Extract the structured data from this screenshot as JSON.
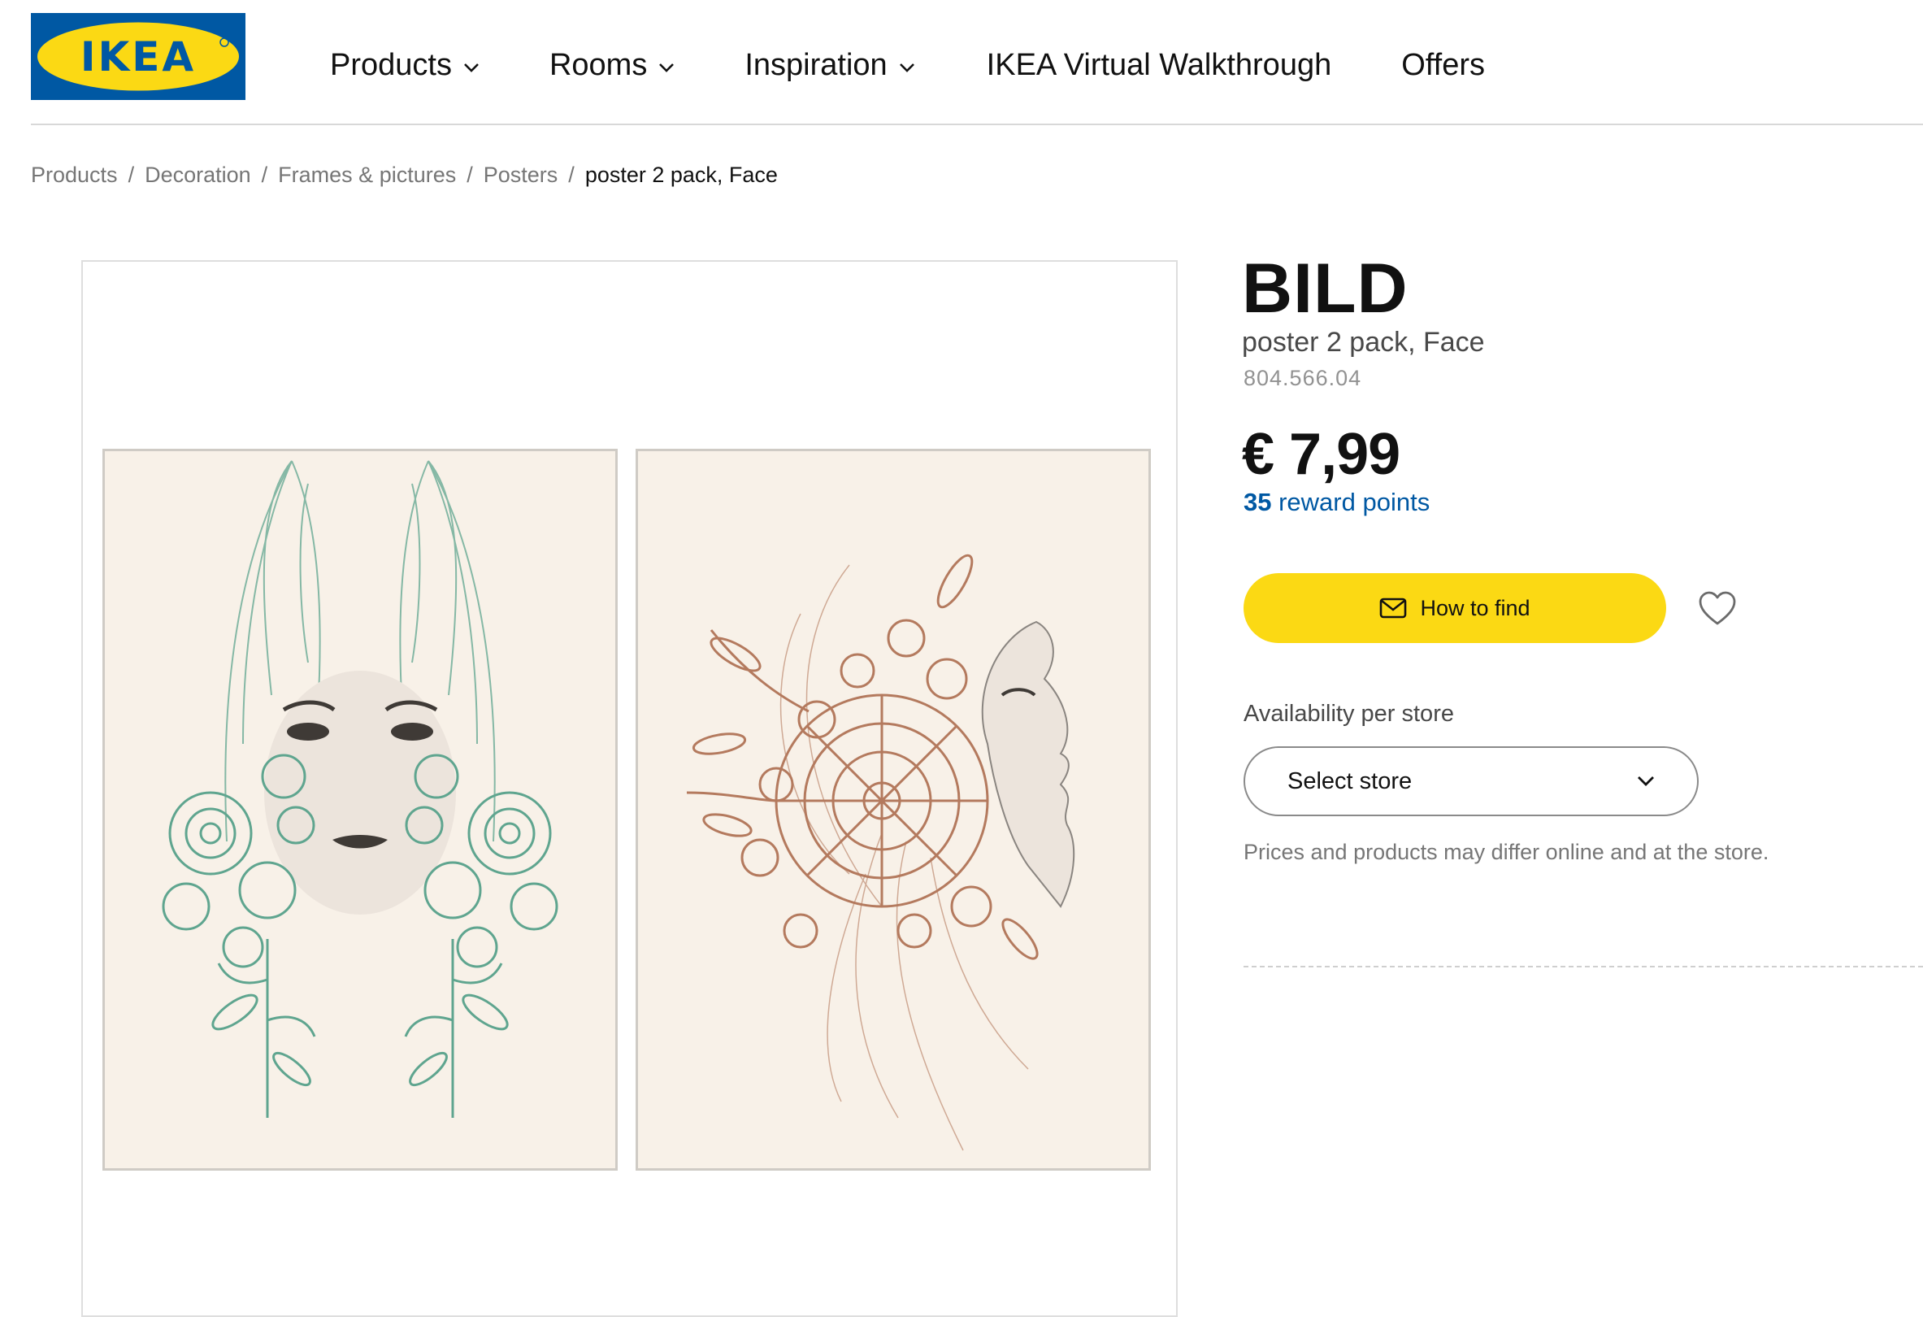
{
  "header": {
    "logo_text": "IKEA",
    "nav": [
      {
        "label": "Products",
        "has_dropdown": true
      },
      {
        "label": "Rooms",
        "has_dropdown": true
      },
      {
        "label": "Inspiration",
        "has_dropdown": true
      },
      {
        "label": "IKEA Virtual Walkthrough",
        "has_dropdown": false
      },
      {
        "label": "Offers",
        "has_dropdown": false
      }
    ]
  },
  "breadcrumb": {
    "items": [
      "Products",
      "Decoration",
      "Frames & pictures",
      "Posters"
    ],
    "current": "poster 2 pack, Face",
    "separator": "/"
  },
  "product": {
    "brand": "BILD",
    "description": "poster 2 pack, Face",
    "article_number": "804.566.04",
    "price": "€ 7,99",
    "reward_points": "35",
    "reward_text": "reward points",
    "how_to_find_label": "How to find",
    "availability_label": "Availability per store",
    "select_store_placeholder": "Select store",
    "note": "Prices and products may differ online and at the store."
  },
  "colors": {
    "ikea_blue": "#0058a3",
    "ikea_yellow": "#fbd914",
    "poster_background": "#f8f1e8",
    "poster_left_ink": "#5fa58f",
    "poster_right_ink": "#b47a5e"
  },
  "icons": {
    "mail": "mail-icon",
    "heart": "heart-icon",
    "chevron": "chevron-down-icon"
  }
}
